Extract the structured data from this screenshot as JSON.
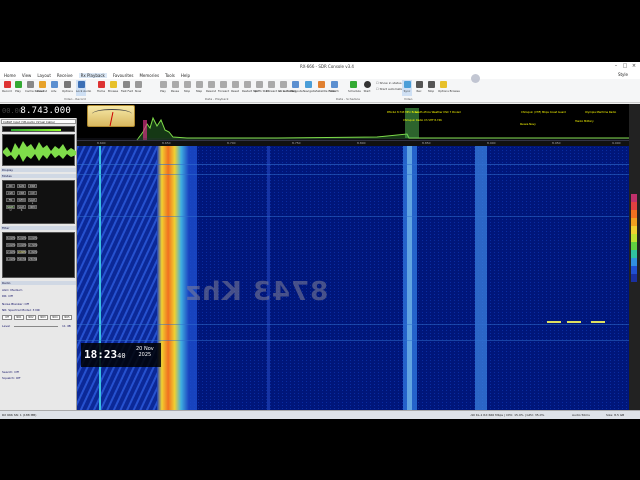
{
  "window": {
    "title": "RX-666 - SDR Console v3.4"
  },
  "menu": {
    "items": [
      "Home",
      "View",
      "Layout",
      "Receive",
      "Rx Playback",
      "Favourites",
      "Memories",
      "Tools",
      "Help"
    ],
    "active": "Rx Playback",
    "user": "Style"
  },
  "ribbon": {
    "buttons": [
      "Record",
      "Play",
      "Cache Record",
      "Rewind",
      "Adv.",
      "Options",
      "Lock Audio",
      "Home",
      "Browse",
      "Fast Fwd",
      "Slow",
      "Play",
      "Pause",
      "Stop",
      "Step",
      "Rewind",
      "Forward",
      "Reset",
      "Restart Split",
      "Go To Start",
      "Forward 10 seconds",
      "Go to Ending",
      "Compute",
      "Navigator",
      "Satellite Editor",
      "Search",
      "Schedule",
      "Start",
      "Show in status bar",
      "Start automatically",
      "Sync",
      "Rec",
      "Stop",
      "Options Browse"
    ],
    "groups": [
      "Video - Record",
      "Data - Playback",
      "Data - Schedule",
      "Video"
    ],
    "check1": "Show in status bar",
    "check2": "Start automatically"
  },
  "sidebar": {
    "receive_label": "Receive",
    "rx_label": "RX 1",
    "frequency": "8.743.000",
    "freq_ghost": "00.00",
    "audio_device": "CABLE Input (VB-Audio Virtual Cable)",
    "sections": {
      "modes": "Modes",
      "display": "Display",
      "filter": "Filter",
      "radio": "Radio"
    },
    "mode_buttons": [
      "AM",
      "SAM",
      "DSB",
      "LSB",
      "USB",
      "CW",
      "FM",
      "WFM",
      "SAM-L",
      "SAM-U",
      "SAM-S",
      "DRM"
    ],
    "filter_buttons": [
      "6.0kHz",
      "5.0kHz",
      "4.0kHz",
      "3.6kHz",
      "3.0kHz",
      "2.7kHz",
      "2.4kHz",
      "2.2kHz",
      "1.8kHz",
      "1.0kHz",
      "500Hz",
      "250Hz"
    ],
    "radio_lines": [
      "AGC: Medium",
      "DR: Off",
      "Noise Blanker: Off",
      "NR: Spectral Model: 3 NR"
    ],
    "nr_buttons": [
      "Off",
      "NR1",
      "NR2",
      "NR3",
      "NR4",
      "NR5"
    ],
    "level_label": "Level",
    "level_value": "11 dB",
    "bottom_lines": [
      "Search: Off",
      "Squelch: Off"
    ]
  },
  "spectrum": {
    "labels": [
      "RTA-SA 8.743 MHz Bravo",
      "South Africa Weather DSC 7 Pooled",
      "Chiloquin Radio Ch VHF 8.746",
      "Chiloquin (VHF) Mbps Coast Guard",
      "Russia Navy",
      "Hanko Military",
      "Olympia Maritime Radio"
    ],
    "scale": [
      "8.600",
      "8.650",
      "8.700",
      "8.750",
      "8.800",
      "8.850",
      "8.900",
      "8.950",
      "9.000"
    ]
  },
  "waterfall": {
    "watermark": "8743 Khz"
  },
  "clock": {
    "time": "18:23",
    "seconds": "40",
    "date_line1": "20 Nov",
    "date_line2": "2025"
  },
  "statusbar": {
    "left": "RX 666 SN: 1 (188 MB)",
    "center": "-90 KL-1 RX 666 Mbps | CPU: 15.9% | GPU: 35.0%",
    "right": "Audio 50ms",
    "size": "Size: 8.5 GB"
  }
}
